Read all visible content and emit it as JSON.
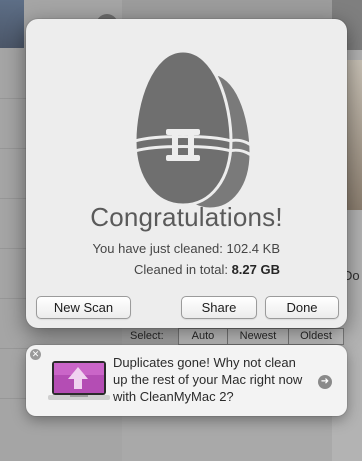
{
  "background": {
    "right_fragment_text": "Do",
    "select_label": "Select:",
    "select_options": [
      "Auto",
      "Newest",
      "Oldest"
    ]
  },
  "dialog": {
    "title": "Congratulations!",
    "cleaned_line": "You have just cleaned: 102.4 KB",
    "total_label": "Cleaned in total:",
    "total_value": "8.27 GB",
    "buttons": {
      "new_scan": "New Scan",
      "share": "Share",
      "done": "Done"
    },
    "icon": "gemini-eggs-icon"
  },
  "notification": {
    "message": "Duplicates gone! Why not clean up the rest of your Mac right now with CleanMyMac 2?",
    "icons": {
      "app": "cleanmymac-app-icon",
      "close": "close-icon",
      "action": "arrow-right-icon"
    }
  },
  "colors": {
    "dialog_bg": "#ededed",
    "egg_fill": "#6f6f6f",
    "title": "#5a5a5a",
    "notification_bg": "#f3f3f3"
  }
}
